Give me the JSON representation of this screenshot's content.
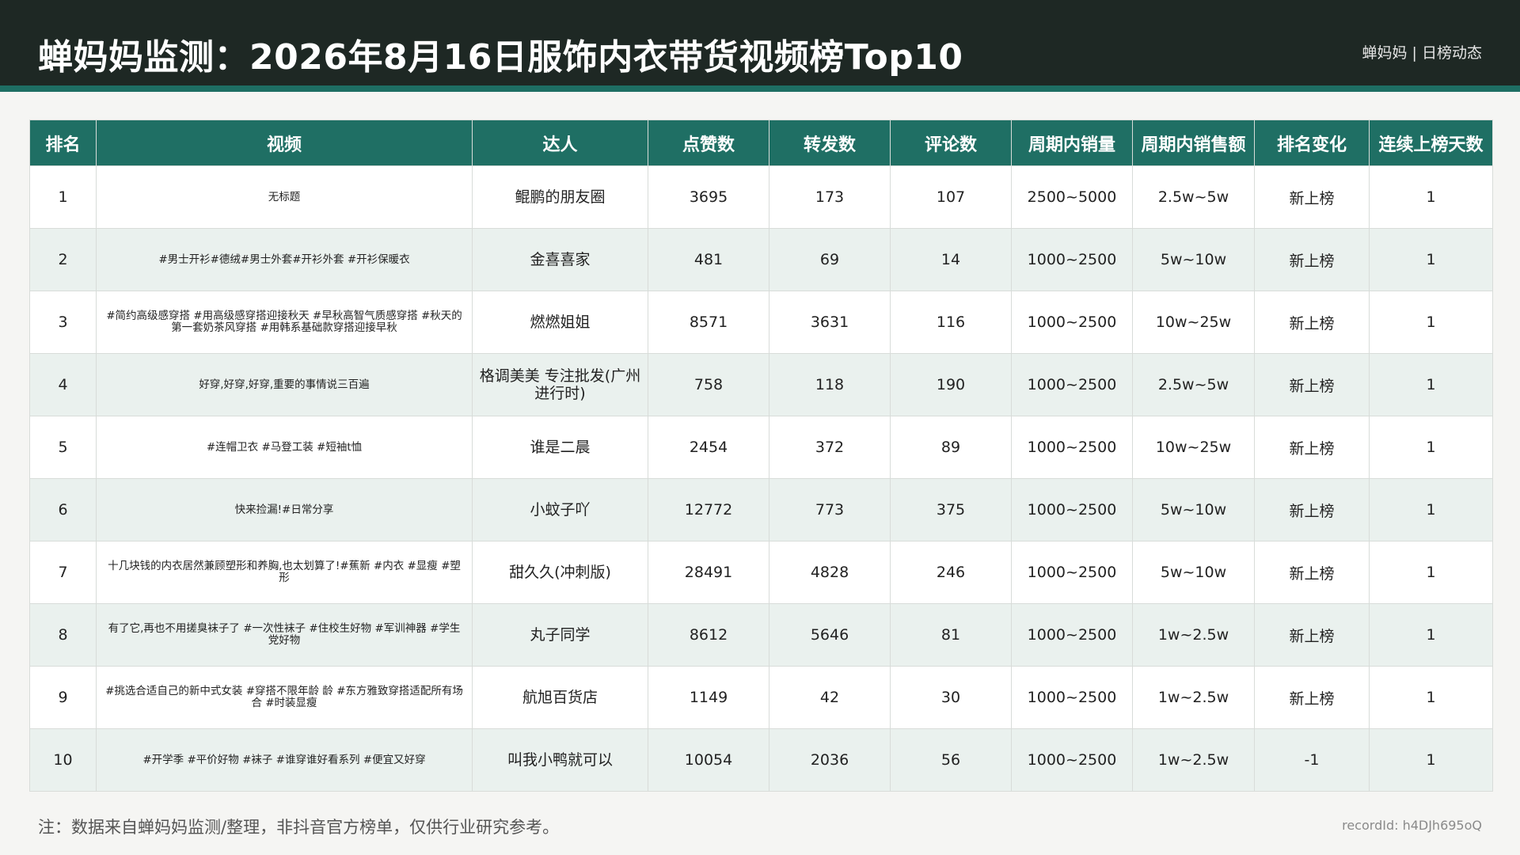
{
  "header": {
    "title": "蝉妈妈监测：2026年8月16日服饰内衣带货视频榜Top10",
    "brand": "蝉妈妈 | 日榜动态"
  },
  "table": {
    "columns": [
      "排名",
      "视频",
      "达人",
      "点赞数",
      "转发数",
      "评论数",
      "周期内销量",
      "周期内销售额",
      "排名变化",
      "连续上榜天数"
    ],
    "rows": [
      {
        "rank": "1",
        "video": "无标题",
        "author": "鲲鹏的朋友圈",
        "likes": "3695",
        "shares": "173",
        "comments": "107",
        "sales_volume": "2500~5000",
        "sales_amount": "2.5w~5w",
        "rank_change": "新上榜",
        "days": "1"
      },
      {
        "rank": "2",
        "video": "#男士开衫#德绒#男士外套#开衫外套 #开衫保暖衣",
        "author": "金喜喜家",
        "likes": "481",
        "shares": "69",
        "comments": "14",
        "sales_volume": "1000~2500",
        "sales_amount": "5w~10w",
        "rank_change": "新上榜",
        "days": "1"
      },
      {
        "rank": "3",
        "video": "#简约高级感穿搭 #用高级感穿搭迎接秋天 #早秋高智气质感穿搭 #秋天的第一套奶茶风穿搭 #用韩系基础款穿搭迎接早秋",
        "author": "燃燃姐姐",
        "likes": "8571",
        "shares": "3631",
        "comments": "116",
        "sales_volume": "1000~2500",
        "sales_amount": "10w~25w",
        "rank_change": "新上榜",
        "days": "1"
      },
      {
        "rank": "4",
        "video": "好穿,好穿,好穿,重要的事情说三百遍",
        "author": "格调美美 专注批发(广州进行时)",
        "likes": "758",
        "shares": "118",
        "comments": "190",
        "sales_volume": "1000~2500",
        "sales_amount": "2.5w~5w",
        "rank_change": "新上榜",
        "days": "1"
      },
      {
        "rank": "5",
        "video": "#连帽卫衣 #马登工装 #短袖t恤",
        "author": "谁是二晨",
        "likes": "2454",
        "shares": "372",
        "comments": "89",
        "sales_volume": "1000~2500",
        "sales_amount": "10w~25w",
        "rank_change": "新上榜",
        "days": "1"
      },
      {
        "rank": "6",
        "video": "快来捡漏!#日常分享",
        "author": "小蚊子吖",
        "likes": "12772",
        "shares": "773",
        "comments": "375",
        "sales_volume": "1000~2500",
        "sales_amount": "5w~10w",
        "rank_change": "新上榜",
        "days": "1"
      },
      {
        "rank": "7",
        "video": "十几块钱的内衣居然兼顾塑形和养胸,也太划算了!#蕉新 #内衣 #显瘦 #塑形",
        "author": "甜久久(冲刺版)",
        "likes": "28491",
        "shares": "4828",
        "comments": "246",
        "sales_volume": "1000~2500",
        "sales_amount": "5w~10w",
        "rank_change": "新上榜",
        "days": "1"
      },
      {
        "rank": "8",
        "video": "有了它,再也不用搓臭袜子了 #一次性袜子 #住校生好物 #军训神器 #学生党好物",
        "author": "丸子同学",
        "likes": "8612",
        "shares": "5646",
        "comments": "81",
        "sales_volume": "1000~2500",
        "sales_amount": "1w~2.5w",
        "rank_change": "新上榜",
        "days": "1"
      },
      {
        "rank": "9",
        "video": "#挑选合适自己的新中式女装 #穿搭不限年龄 龄 #东方雅致穿搭适配所有场合 #时装显瘦",
        "author": "航旭百货店",
        "likes": "1149",
        "shares": "42",
        "comments": "30",
        "sales_volume": "1000~2500",
        "sales_amount": "1w~2.5w",
        "rank_change": "新上榜",
        "days": "1"
      },
      {
        "rank": "10",
        "video": "#开学季 #平价好物 #袜子 #谁穿谁好看系列 #便宜又好穿",
        "author": "叫我小鸭就可以",
        "likes": "10054",
        "shares": "2036",
        "comments": "56",
        "sales_volume": "1000~2500",
        "sales_amount": "1w~2.5w",
        "rank_change": "-1",
        "days": "1"
      }
    ]
  },
  "footer": {
    "note": "注：数据来自蝉妈妈监测/整理，非抖音官方榜单，仅供行业研究参考。",
    "record_id": "recordId: h4DJh695oQ"
  },
  "colors": {
    "header_bg": "#1e2824",
    "accent": "#1f6f64",
    "row_alt": "#eaf1ee",
    "page_bg": "#f5f5f3"
  }
}
